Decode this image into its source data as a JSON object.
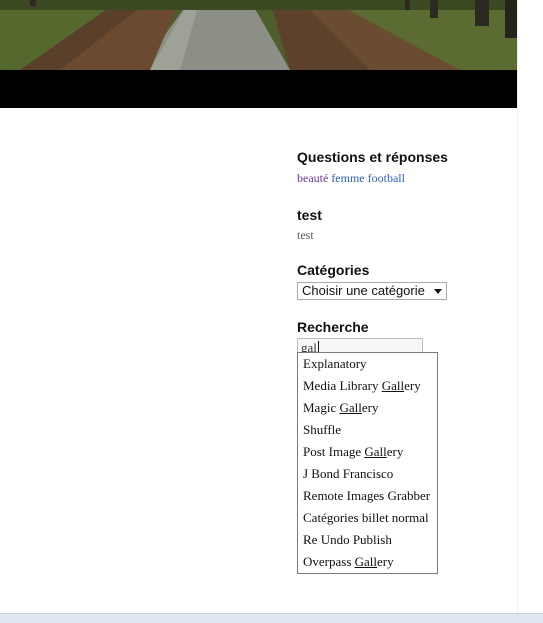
{
  "sidebar": {
    "qa": {
      "title": "Questions et réponses",
      "tags": [
        "beauté",
        "femme",
        "football"
      ]
    },
    "test": {
      "title": "test",
      "text": "test"
    },
    "categories": {
      "title": "Catégories",
      "select_value": "Choisir une catégorie"
    },
    "search": {
      "title": "Recherche",
      "value": "gal"
    }
  },
  "autocomplete": {
    "items": [
      {
        "before": "Explanatory",
        "match": "",
        "after": ""
      },
      {
        "before": "Media Library ",
        "match": "Gall",
        "after": "ery"
      },
      {
        "before": "Magic ",
        "match": "Gall",
        "after": "ery"
      },
      {
        "before": "Shuffle",
        "match": "",
        "after": ""
      },
      {
        "before": "Post Image ",
        "match": "Gall",
        "after": "ery"
      },
      {
        "before": "J Bond Francisco",
        "match": "",
        "after": ""
      },
      {
        "before": "Remote Images Grabber",
        "match": "",
        "after": ""
      },
      {
        "before": "Catégories billet normal",
        "match": "",
        "after": ""
      },
      {
        "before": "Re Undo Publish",
        "match": "",
        "after": ""
      },
      {
        "before": "Overpass ",
        "match": "Gall",
        "after": "ery"
      }
    ]
  },
  "colors": {
    "tag_visited": "#6a3a9e",
    "tag_link": "#2f5fbf",
    "header_bar": "#000000"
  }
}
